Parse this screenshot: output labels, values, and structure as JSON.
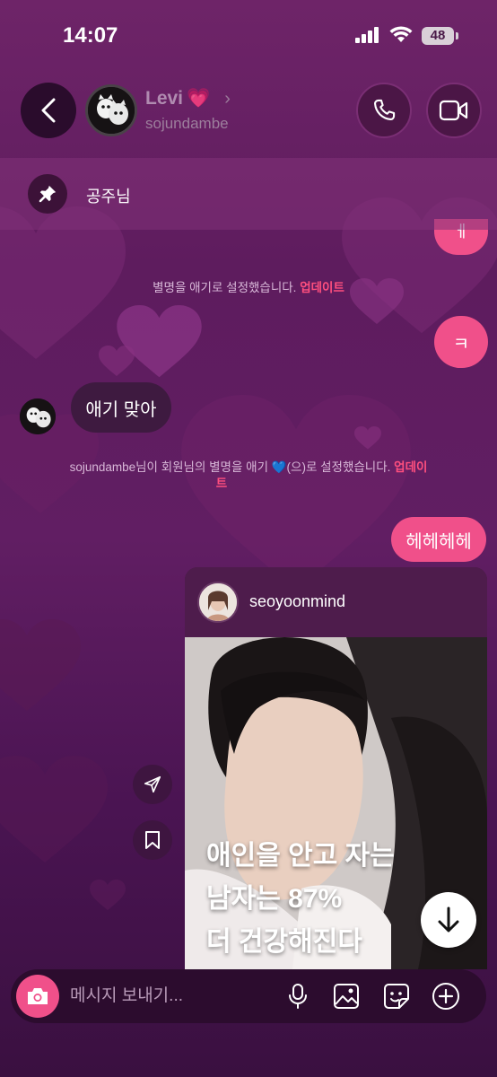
{
  "status_bar": {
    "time": "14:07",
    "battery": "48"
  },
  "header": {
    "name": "Levi",
    "name_emoji": "💗",
    "username": "sojundambe"
  },
  "pinned": {
    "text": "공주님"
  },
  "messages": {
    "out_top_partial": "ㅔ",
    "system1_text": "별명을 애기로 설정했습니다.",
    "system1_link": "업데이트",
    "out_k": "ㅋ",
    "in_text": "애기 맞아",
    "system2_text": "sojundambe님이 회원님의 별명을 애기 💙(으)로 설정했습니다.",
    "system2_link_a": "업데이",
    "system2_link_b": "트",
    "out_hehe": "헤헤헤헤"
  },
  "shared_post": {
    "username": "seoyoonmind",
    "caption_line1": "애인을 안고 자는",
    "caption_line2": "남자는 87%",
    "caption_line3": "더 건강해진다"
  },
  "composer": {
    "placeholder": "메시지 보내기..."
  },
  "colors": {
    "accent_pink": "#f0508a",
    "link_red": "#ff4f7e",
    "bg_purple": "#611e63"
  }
}
